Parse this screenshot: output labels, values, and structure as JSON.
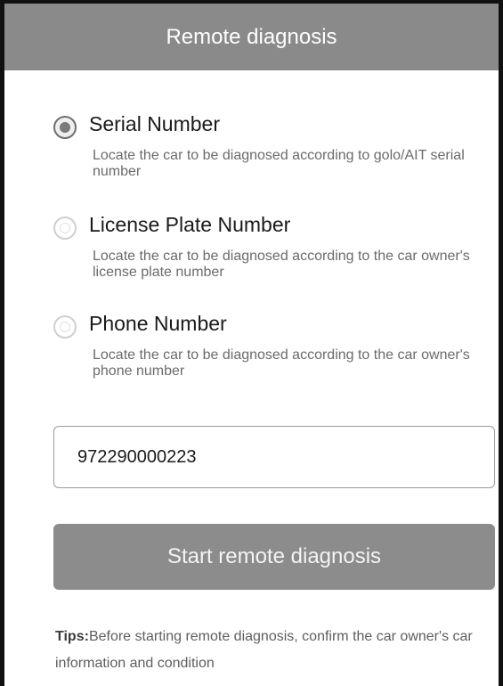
{
  "header": {
    "title": "Remote diagnosis"
  },
  "options": [
    {
      "label": "Serial Number",
      "description": "Locate the car to be diagnosed according to golo/AIT serial number",
      "selected": true
    },
    {
      "label": "License Plate Number",
      "description": "Locate the car to be diagnosed according to the car owner's license plate number",
      "selected": false
    },
    {
      "label": "Phone Number",
      "description": "Locate the car to be diagnosed according to the car owner's phone number",
      "selected": false
    }
  ],
  "input": {
    "value": "972290000223"
  },
  "start_button": {
    "label": "Start remote diagnosis"
  },
  "tips": {
    "label": "Tips:",
    "text": "Before starting remote diagnosis, confirm the car owner's car information and condition"
  },
  "colors": {
    "header_bg": "#8a8a8a",
    "button_bg": "#8c8c8c",
    "text_primary": "#1a1a1a",
    "text_secondary": "#6b6b6b"
  }
}
